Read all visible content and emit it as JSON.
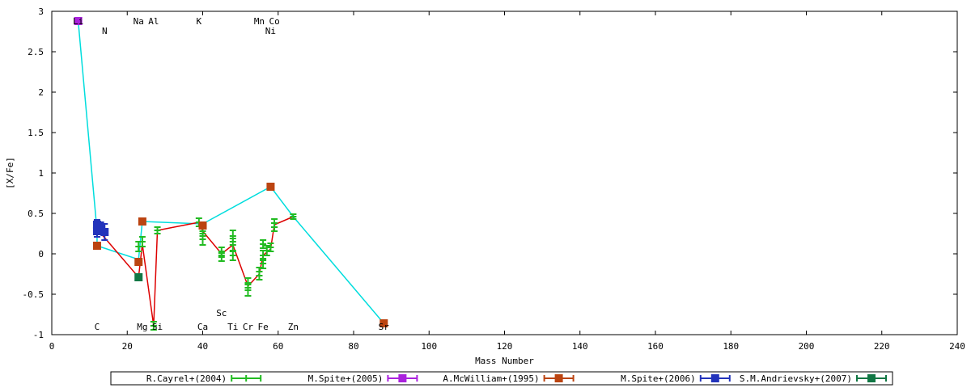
{
  "chart_data": {
    "type": "line",
    "title": "",
    "xlabel": "Mass Number",
    "ylabel": "[X/Fe]",
    "xlim": [
      0,
      240
    ],
    "ylim": [
      -1,
      3
    ],
    "x_ticks": [
      0,
      20,
      40,
      60,
      80,
      100,
      120,
      140,
      160,
      180,
      200,
      220,
      240
    ],
    "y_ticks": [
      -1,
      -0.5,
      0,
      0.5,
      1,
      1.5,
      2,
      2.5,
      3
    ],
    "y_tick_labels": [
      "-1",
      "-0.5",
      "0",
      "0.5",
      "1",
      "1.5",
      "2",
      "2.5",
      "3"
    ],
    "grid": false,
    "legend_position": "bottom",
    "element_labels": [
      {
        "text": "Li",
        "x": 7,
        "y": 2.88
      },
      {
        "text": "N",
        "x": 14,
        "y": 2.76
      },
      {
        "text": "Na",
        "x": 23,
        "y": 2.88
      },
      {
        "text": "Al",
        "x": 27,
        "y": 2.88
      },
      {
        "text": "K",
        "x": 39,
        "y": 2.88
      },
      {
        "text": "Mn",
        "x": 55,
        "y": 2.88
      },
      {
        "text": "Co",
        "x": 59,
        "y": 2.88
      },
      {
        "text": "Ni",
        "x": 58,
        "y": 2.76
      },
      {
        "text": "C",
        "x": 12,
        "y": -0.9
      },
      {
        "text": "Mg",
        "x": 24,
        "y": -0.9
      },
      {
        "text": "Si",
        "x": 28,
        "y": -0.9
      },
      {
        "text": "Ca",
        "x": 40,
        "y": -0.9
      },
      {
        "text": "Sc",
        "x": 45,
        "y": -0.73
      },
      {
        "text": "Ti",
        "x": 48,
        "y": -0.9
      },
      {
        "text": "Cr",
        "x": 52,
        "y": -0.9
      },
      {
        "text": "Fe",
        "x": 56,
        "y": -0.9
      },
      {
        "text": "Zn",
        "x": 64,
        "y": -0.9
      },
      {
        "text": "Sr",
        "x": 88,
        "y": -0.9
      }
    ],
    "series": [
      {
        "name": "R.Cayrel+(2004)",
        "color": "#22bb22",
        "points": [
          {
            "x": 23,
            "y": 0.09,
            "err": 0.06
          },
          {
            "x": 24,
            "y": 0.15,
            "err": 0.06
          },
          {
            "x": 27,
            "y": -0.89,
            "err": 0.05
          },
          {
            "x": 28,
            "y": 0.29,
            "err": 0.04
          },
          {
            "x": 39,
            "y": 0.39,
            "err": 0.05
          },
          {
            "x": 40,
            "y": 0.28,
            "err": 0.06
          },
          {
            "x": 40,
            "y": 0.18,
            "err": 0.07
          },
          {
            "x": 45,
            "y": 0.03,
            "err": 0.05
          },
          {
            "x": 45,
            "y": -0.04,
            "err": 0.05
          },
          {
            "x": 48,
            "y": 0.22,
            "err": 0.07
          },
          {
            "x": 48,
            "y": 0.11,
            "err": 0.08
          },
          {
            "x": 48,
            "y": -0.02,
            "err": 0.06
          },
          {
            "x": 52,
            "y": -0.36,
            "err": 0.06
          },
          {
            "x": 52,
            "y": -0.45,
            "err": 0.07
          },
          {
            "x": 55,
            "y": -0.22,
            "err": 0.05
          },
          {
            "x": 55,
            "y": -0.27,
            "err": 0.05
          },
          {
            "x": 56,
            "y": 0.12,
            "err": 0.05
          },
          {
            "x": 56,
            "y": -0.02,
            "err": 0.06
          },
          {
            "x": 56,
            "y": -0.12,
            "err": 0.06
          },
          {
            "x": 57,
            "y": 0.04,
            "err": 0.06
          },
          {
            "x": 58,
            "y": 0.08,
            "err": 0.05
          },
          {
            "x": 59,
            "y": 0.38,
            "err": 0.05
          },
          {
            "x": 59,
            "y": 0.33,
            "err": 0.05
          },
          {
            "x": 64,
            "y": 0.46,
            "err": 0.03
          }
        ]
      },
      {
        "name": "M.Spite+(2005)",
        "color": "#aa22dd",
        "points": [
          {
            "x": 7,
            "y": 2.88,
            "err": 0.04
          }
        ]
      },
      {
        "name": "A.McWilliam+(1995)",
        "color": "#bb4411",
        "points": [
          {
            "x": 12,
            "y": 0.1,
            "err": 0
          },
          {
            "x": 23,
            "y": -0.1,
            "err": 0
          },
          {
            "x": 24,
            "y": 0.4,
            "err": 0
          },
          {
            "x": 40,
            "y": 0.35,
            "err": 0
          },
          {
            "x": 58,
            "y": 0.83,
            "err": 0
          },
          {
            "x": 88,
            "y": -0.86,
            "err": 0
          }
        ]
      },
      {
        "name": "M.Spite+(2006)",
        "color": "#2233bb",
        "points": [
          {
            "x": 12,
            "y": 0.36,
            "err": 0.06
          },
          {
            "x": 12,
            "y": 0.28,
            "err": 0.07
          },
          {
            "x": 13,
            "y": 0.32,
            "err": 0.07
          },
          {
            "x": 14,
            "y": 0.27,
            "err": 0.1
          }
        ]
      },
      {
        "name": "S.M.Andrievsky+(2007)",
        "color": "#117744",
        "points": [
          {
            "x": 23,
            "y": -0.29,
            "err": 0.02
          }
        ]
      }
    ],
    "connecting_lines": [
      {
        "color": "#00dddd",
        "points": [
          {
            "x": 7,
            "y": 2.88
          },
          {
            "x": 12,
            "y": 0.28
          },
          {
            "x": 12,
            "y": 0.1
          },
          {
            "x": 23,
            "y": -0.07
          },
          {
            "x": 24,
            "y": 0.4
          },
          {
            "x": 40,
            "y": 0.37
          },
          {
            "x": 58,
            "y": 0.83
          },
          {
            "x": 64,
            "y": 0.46
          },
          {
            "x": 88,
            "y": -0.86
          }
        ]
      },
      {
        "color": "#dd0000",
        "points": [
          {
            "x": 12,
            "y": 0.28
          },
          {
            "x": 13,
            "y": 0.25
          },
          {
            "x": 14,
            "y": 0.2
          },
          {
            "x": 23,
            "y": -0.29
          },
          {
            "x": 24,
            "y": 0.12
          },
          {
            "x": 27,
            "y": -0.89
          },
          {
            "x": 28,
            "y": 0.29
          },
          {
            "x": 39,
            "y": 0.39
          },
          {
            "x": 40,
            "y": 0.28
          },
          {
            "x": 45,
            "y": 0.0
          },
          {
            "x": 48,
            "y": 0.11
          },
          {
            "x": 52,
            "y": -0.4
          },
          {
            "x": 55,
            "y": -0.25
          },
          {
            "x": 56,
            "y": -0.02
          },
          {
            "x": 58,
            "y": 0.06
          },
          {
            "x": 59,
            "y": 0.36
          },
          {
            "x": 64,
            "y": 0.46
          }
        ]
      }
    ]
  }
}
